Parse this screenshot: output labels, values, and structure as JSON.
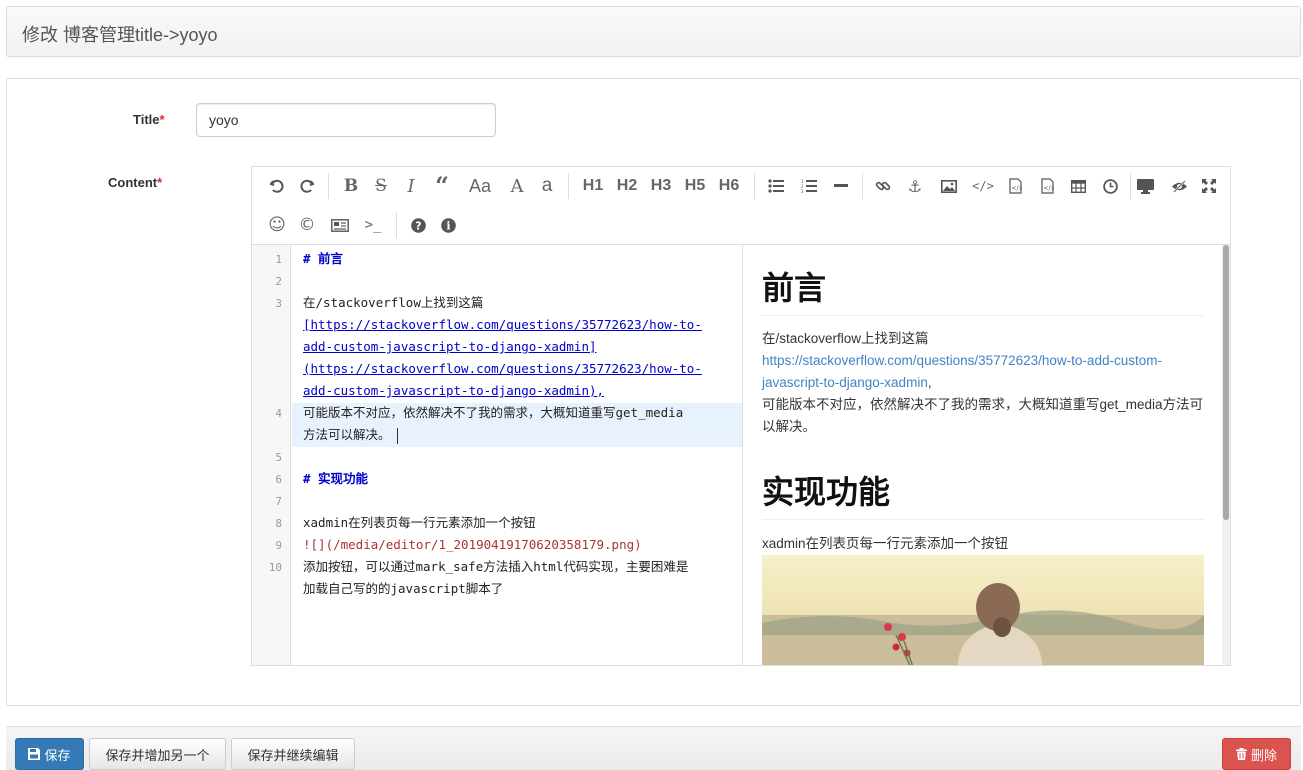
{
  "header": {
    "title": "修改 博客管理title->yoyo"
  },
  "form": {
    "title_label": "Title",
    "content_label": "Content",
    "required_mark": "*",
    "title_value": "yoyo"
  },
  "toolbar": {
    "row1": [
      "undo-icon",
      "redo-icon",
      "bold-icon",
      "strikethrough-icon",
      "italic-icon",
      "quote-icon",
      "uppercase-icon",
      "letter-a-icon",
      "lowercase-icon",
      "H1",
      "H2",
      "H3",
      "H5",
      "H6",
      "unordered-list-icon",
      "ordered-list-icon",
      "hr-icon",
      "link-icon",
      "anchor-icon",
      "image-icon",
      "code-icon",
      "preformatted-code-icon",
      "code-block-icon",
      "table-icon",
      "datetime-icon",
      "watch-icon",
      "preview-icon",
      "fullscreen-icon"
    ],
    "row2": [
      "emoji-icon",
      "html-entities-icon",
      "pagebreak-icon",
      "terminal-icon",
      "help-icon",
      "info-icon"
    ],
    "headings": [
      "H1",
      "H2",
      "H3",
      "H5",
      "H6"
    ]
  },
  "code_lines": [
    {
      "num": "1",
      "text": "# 前言"
    },
    {
      "num": "2",
      "text": ""
    },
    {
      "num": "3",
      "text": "在/stackoverflow上找到这篇"
    },
    {
      "text": "[https://stackoverflow.com/questions/35772623/how-to-"
    },
    {
      "text": "add-custom-javascript-to-django-xadmin]"
    },
    {
      "text": "(https://stackoverflow.com/questions/35772623/how-to-"
    },
    {
      "text": "add-custom-javascript-to-django-xadmin),"
    },
    {
      "num": "4",
      "text": "可能版本不对应，依然解决不了我的需求，大概知道重写get_media"
    },
    {
      "text": "方法可以解决。"
    },
    {
      "num": "5",
      "text": ""
    },
    {
      "num": "6",
      "text": "# 实现功能"
    },
    {
      "num": "7",
      "text": ""
    },
    {
      "num": "8",
      "text": "xadmin在列表页每一行元素添加一个按钮"
    },
    {
      "num": "9",
      "text": "![](/media/editor/1_20190419170620358179.png)"
    },
    {
      "num": "10",
      "text": "添加按钮，可以通过mark_safe方法插入html代码实现，主要困难是"
    },
    {
      "text": "加载自己写的的javascript脚本了"
    }
  ],
  "preview": {
    "h1_a": "前言",
    "p1_a": "在/stackoverflow上找到这篇",
    "link": "https://stackoverflow.com/questions/35772623/how-to-add-custom-javascript-to-django-xadmin",
    "link_after": ",",
    "p1_b": "可能版本不对应，依然解决不了我的需求，大概知道重写get_media方法可以解决。",
    "h1_b": "实现功能",
    "p2": "xadmin在列表页每一行元素添加一个按钮"
  },
  "footer": {
    "save": "保存",
    "save_add": "保存并增加另一个",
    "save_continue": "保存并继续编辑",
    "delete": "删除"
  },
  "colors": {
    "primary": "#337ab7",
    "danger": "#d9534f",
    "link": "#4183c4",
    "md_header": "#0000cc"
  }
}
